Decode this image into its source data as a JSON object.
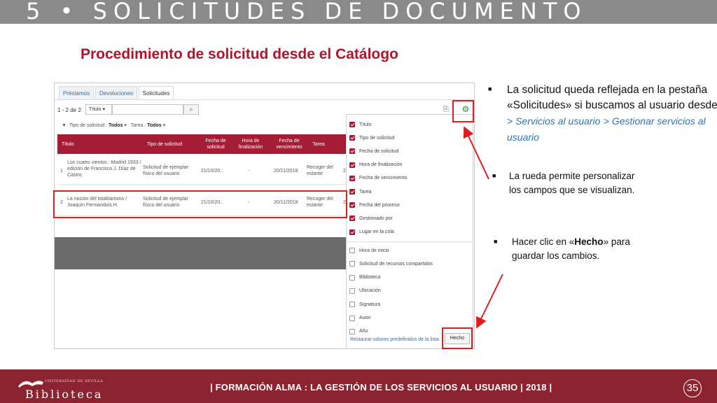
{
  "slide": {
    "title": "5 • SOLICITUDES DE DOCUMENTO",
    "subtitle": "Procedimiento de solicitud desde el Catálogo",
    "page_number": "35",
    "footer_text": "| FORMACIÓN ALMA :  LA GESTIÓN DE LOS SERVICIOS AL USUARIO | 2018 |",
    "logo": {
      "name": "Biblioteca",
      "small_text": "UNIVERSIDAD DE SEVILLA"
    },
    "colors": {
      "brand": "#8c2430",
      "accent": "#b0152b",
      "highlight": "#e01d1d",
      "link": "#2d74b5"
    }
  },
  "bullets": {
    "b1_text": "La solicitud queda reflejada en la pestaña «Solicitudes» si buscamos al usuario desde",
    "b1_link1": "> Servicios al usuario",
    "b1_link2": "> Gestionar servicios al usuario",
    "b2_text": "La rueda permite personalizar los campos que se visualizan.",
    "b3_pre": "Hacer clic en «",
    "b3_bold": "Hecho",
    "b3_post": "» para guardar los cambios."
  },
  "app": {
    "tabs": [
      "Préstamos",
      "Devoluciones",
      "Solicitudes"
    ],
    "active_tab": "Solicitudes",
    "count": "1 - 2 de 2",
    "search_field": "Título",
    "filter_type_label": "Tipo de solicitud :",
    "filter_type_value": "Todos",
    "filter_task_label": "Tarea :",
    "filter_task_value": "Todos",
    "icons": {
      "export": "export-icon",
      "gear": "gear-icon",
      "search": "search-icon",
      "filter": "filter-icon"
    },
    "columns": [
      "Título",
      "Tipo de solicitud",
      "Fecha de solicitud",
      "Hora de finalización",
      "Fecha de vencimiento",
      "Tarea"
    ],
    "rows": [
      {
        "num": "1",
        "title": "Los cuatro vientos : Madrid 1933 / edición de Francisco J. Díaz de Castro",
        "type": "Solicitud de ejemplar físico del usuario",
        "date": "21/10/20..",
        "time": "-",
        "due": "20/11/2018",
        "task": "Recoger del estante",
        "extra": "2"
      },
      {
        "num": "2",
        "title": "La noción del totalitarismo / Joaquín Fermandois H.",
        "type": "Solicitud de ejemplar físico del usuario",
        "date": "21/10/20..",
        "time": "-",
        "due": "20/11/2018",
        "task": "Recoger del estante",
        "extra": "2"
      }
    ],
    "chooser": {
      "options": [
        {
          "label": "Título",
          "checked": true
        },
        {
          "label": "Tipo de solicitud",
          "checked": true
        },
        {
          "label": "Fecha de solicitud",
          "checked": true
        },
        {
          "label": "Hora de finalización",
          "checked": true
        },
        {
          "label": "Fecha de vencimiento",
          "checked": true
        },
        {
          "label": "Tarea",
          "checked": true
        },
        {
          "label": "Fecha del proceso",
          "checked": true
        },
        {
          "label": "Gestionado por",
          "checked": true
        },
        {
          "label": "Lugar en la cola",
          "checked": true
        },
        {
          "label": "Hora de inicio",
          "checked": false
        },
        {
          "label": "Solicitud de recursos compartidos",
          "checked": false
        },
        {
          "label": "Biblioteca",
          "checked": false
        },
        {
          "label": "Ubicación",
          "checked": false
        },
        {
          "label": "Signatura",
          "checked": false
        },
        {
          "label": "Autor",
          "checked": false
        },
        {
          "label": "Año",
          "checked": false
        }
      ],
      "restore_label": "Restaurar valores predefinidos de la lista",
      "done_label": "Hecho"
    }
  }
}
